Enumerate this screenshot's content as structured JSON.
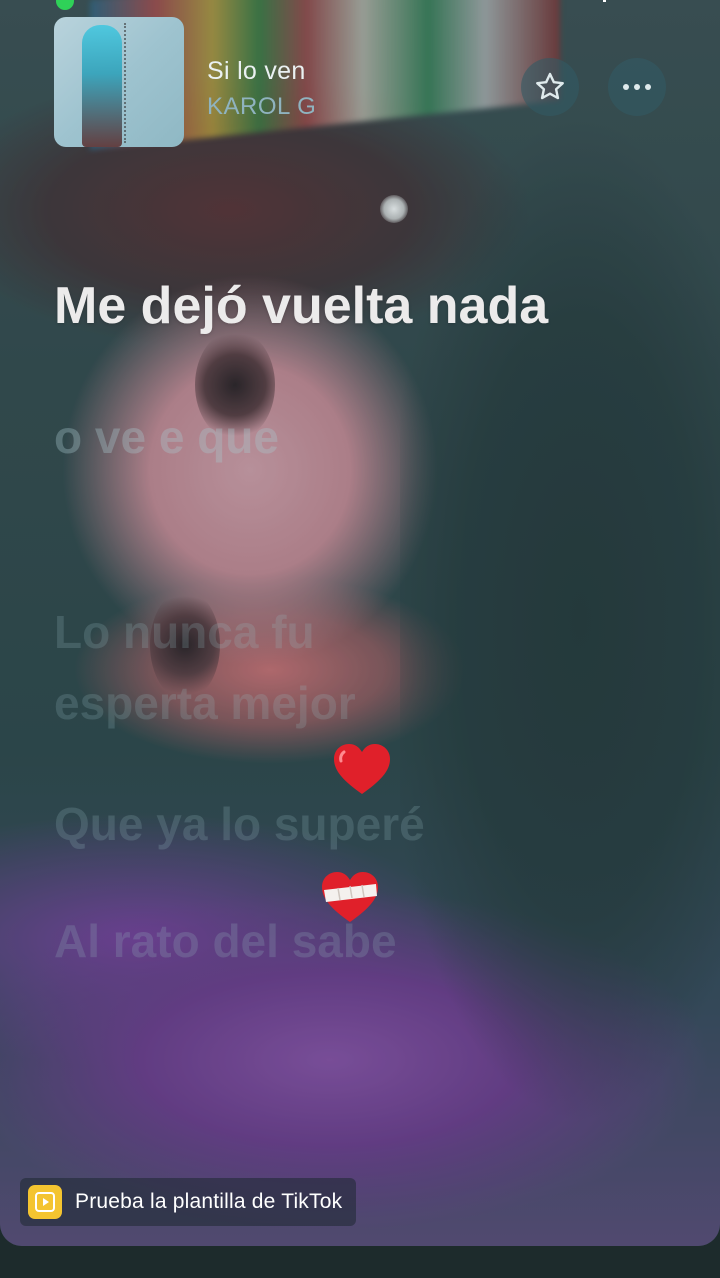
{
  "song": {
    "title": "Si lo ven",
    "artist": "KAROL G"
  },
  "actions": {
    "favorite_icon": "star-icon",
    "more_icon": "more-horizontal-icon"
  },
  "lyrics": {
    "current": "Me dejó vuelta nada",
    "next": "o ve          e que",
    "faded_3": "Lo nunca fu",
    "faded_4": "esperta mejor",
    "faded_5": "Que ya lo superé",
    "faded_6": "Al rato del sabe"
  },
  "emojis": {
    "heart": "❤️",
    "mending_heart": "❤️‍🩹"
  },
  "template_badge": {
    "label": "Prueba la plantilla de TikTok",
    "icon": "template-play-icon",
    "icon_color": "#f4c430"
  },
  "status": {
    "camera_indicator_color": "#2fd158"
  }
}
